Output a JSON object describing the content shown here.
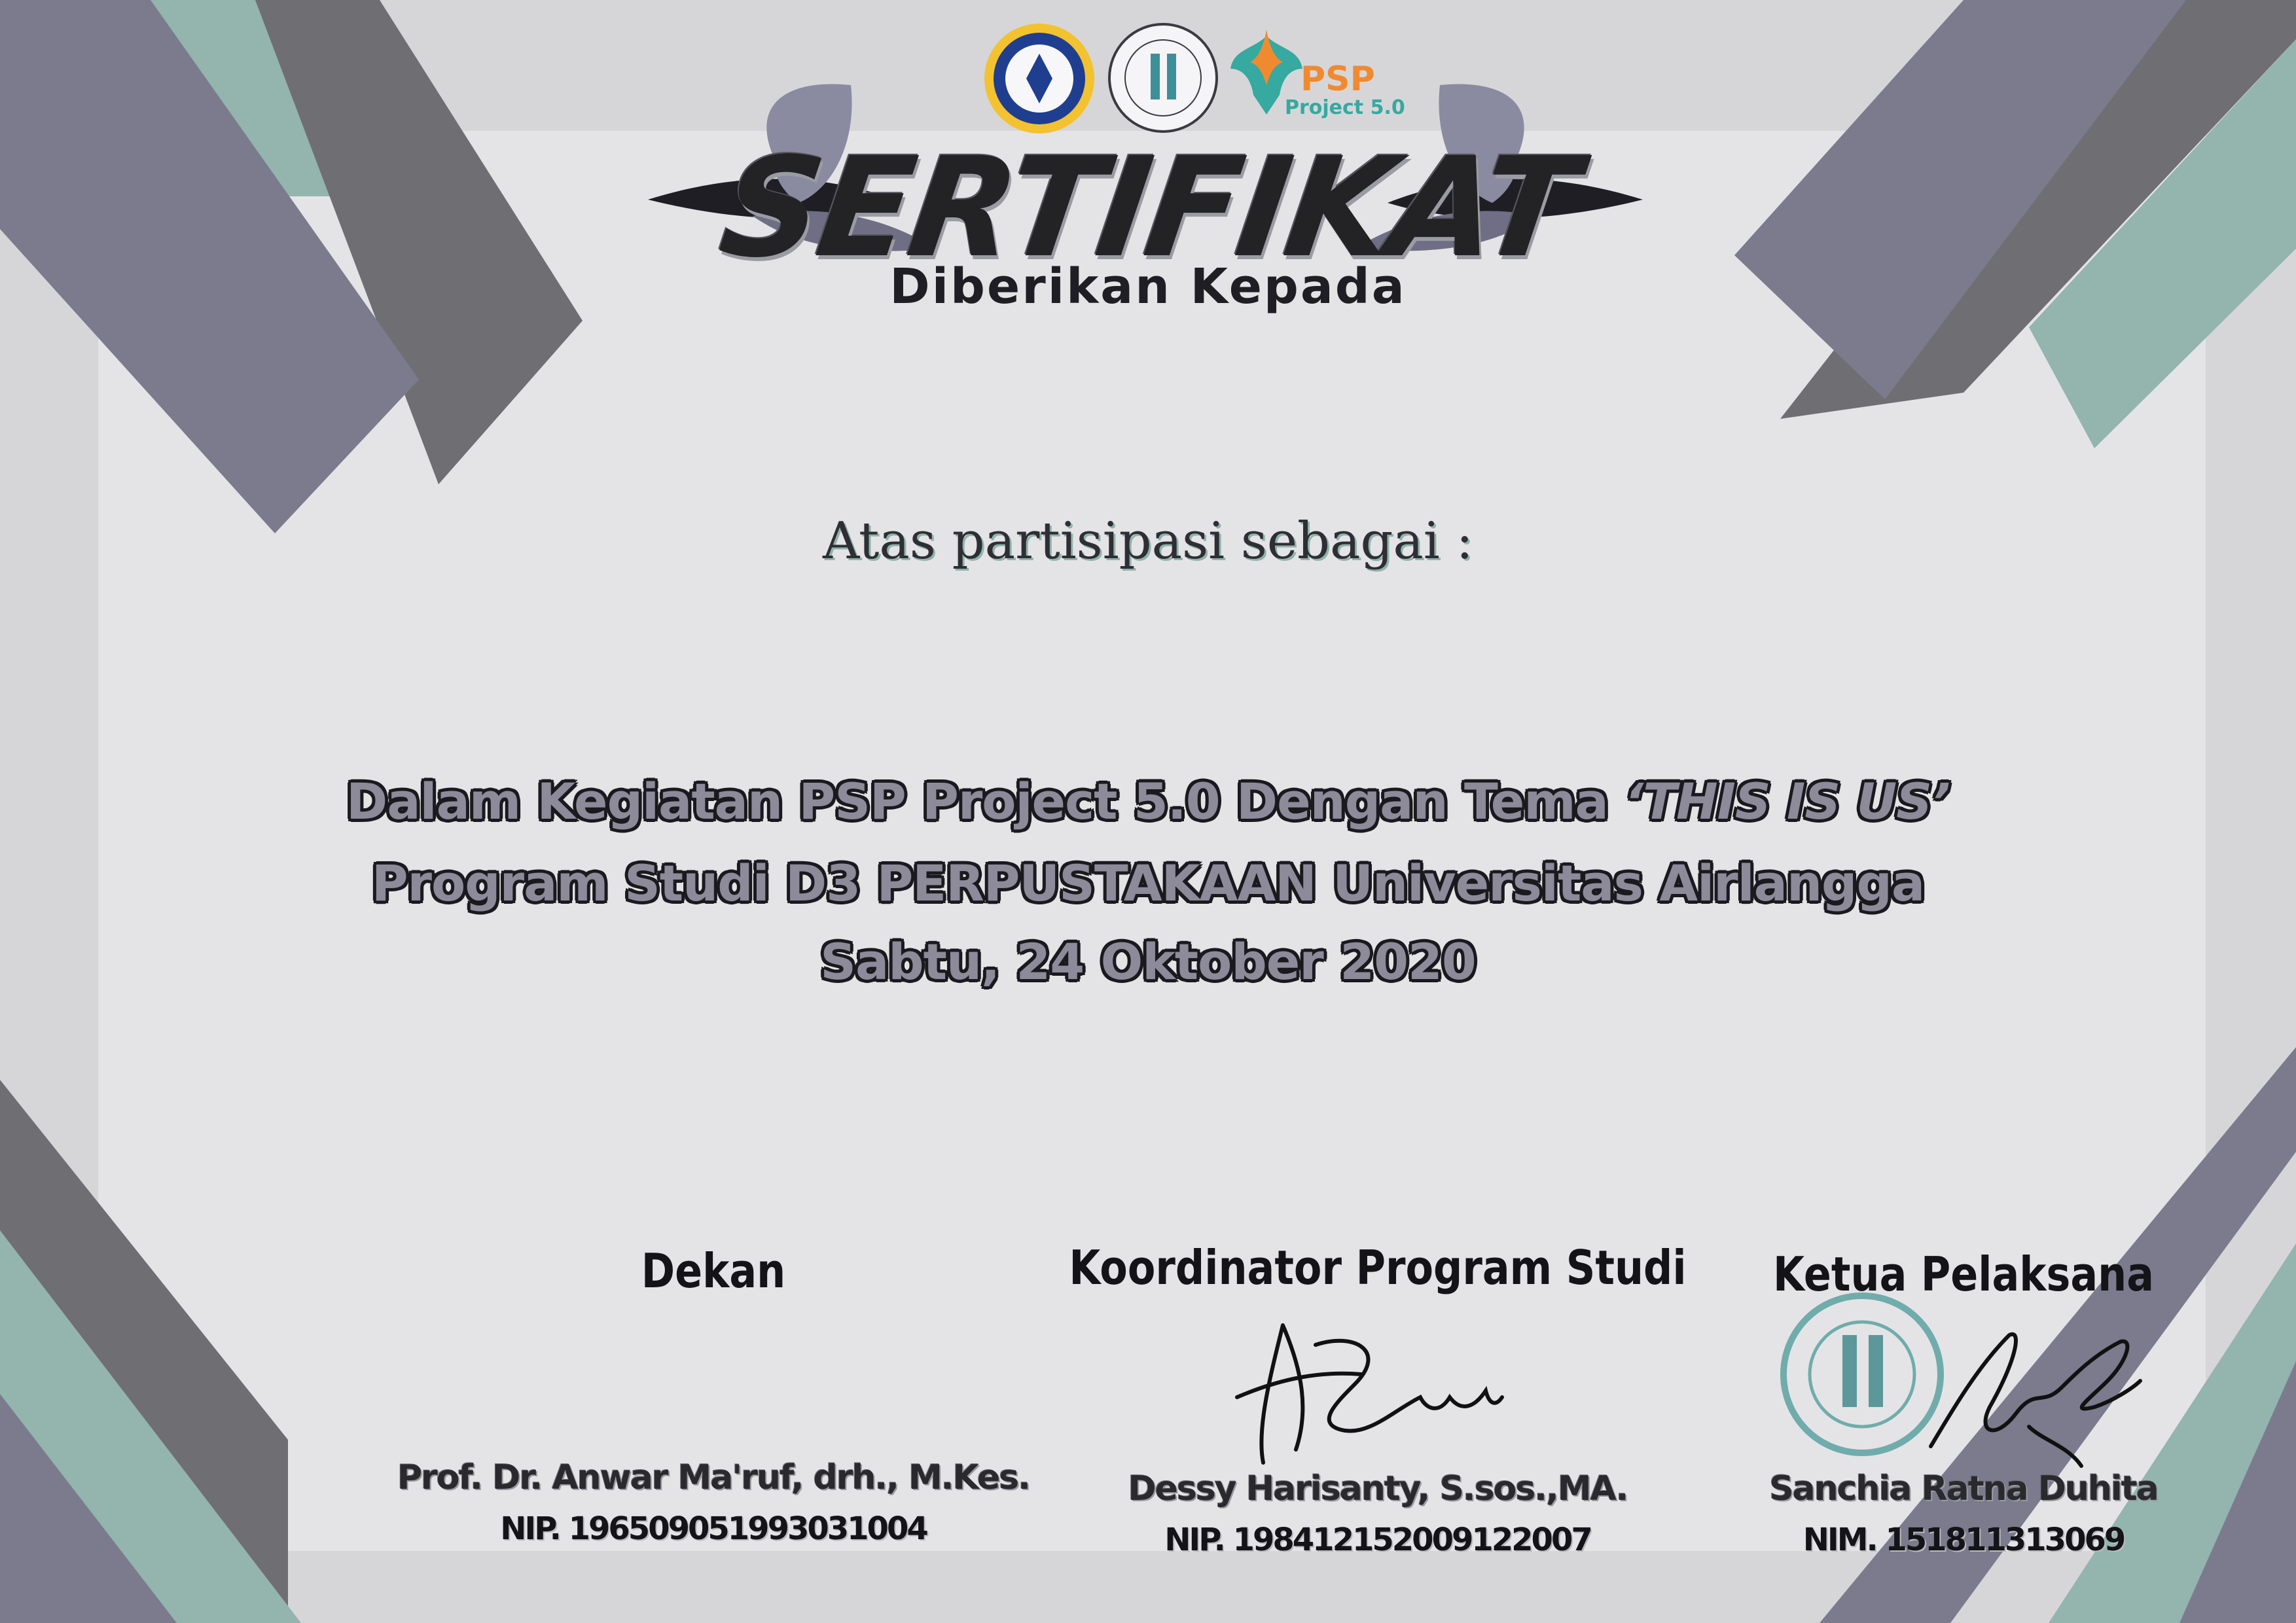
{
  "certificate": {
    "title": "SERTIFIKAT",
    "subtitle": "Diberikan Kepada",
    "participation": "Atas partisipasi sebagai :",
    "event_line1_prefix": "Dalam Kegiatan PSP Project 5.0 Dengan Tema",
    "event_theme": "‘THIS IS US’",
    "event_line2": "Program Studi D3 PERPUSTAKAAN Universitas Airlangga",
    "event_line3": "Sabtu, 24 Oktober 2020"
  },
  "logos": {
    "logo1": "university-seal-icon",
    "logo2": "study-program-logo-icon",
    "logo3_text": "PSP",
    "logo3_subtext": "Project 5.0"
  },
  "signatories": [
    {
      "role": "Dekan",
      "name": "Prof. Dr. Anwar Ma'ruf, drh., M.Kes.",
      "id": "NIP. 196509051993031004"
    },
    {
      "role": "Koordinator Program Studi",
      "name": "Dessy Harisanty, S.sos.,MA.",
      "id": "NIP. 198412152009122007"
    },
    {
      "role": "Ketua Pelaksana",
      "name": "Sanchia Ratna Duhita",
      "id": "NIM. 151811313069"
    }
  ],
  "colors": {
    "background": "#d6d6d8",
    "panel": "#e4e4e6",
    "slate": "#7c7b8d",
    "dark_gray": "#6f6e73",
    "sage": "#94b4ae",
    "text_dark": "#1e1e24"
  }
}
